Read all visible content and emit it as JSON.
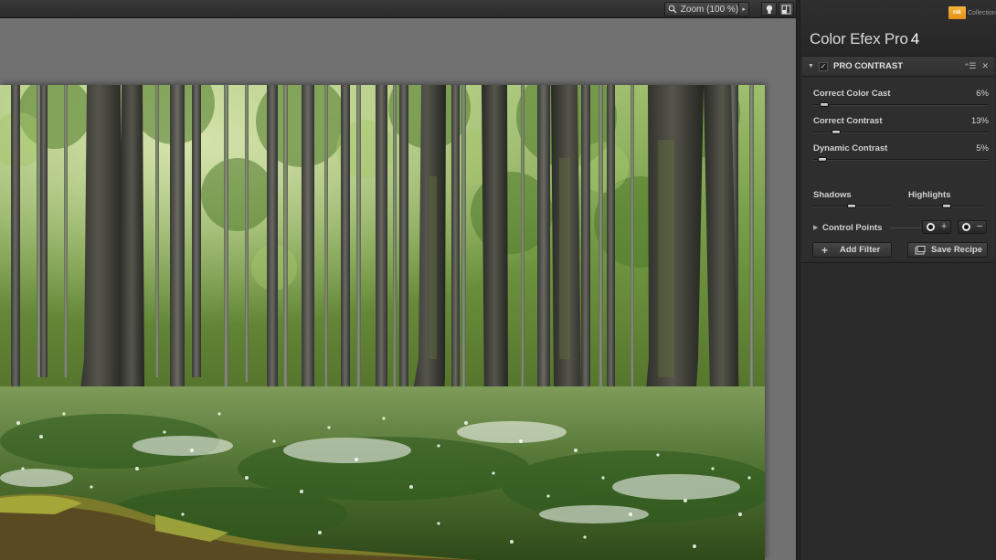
{
  "toolbar": {
    "zoom_label": "Zoom (100 %)",
    "zoom_arrow": "▸",
    "icons": [
      "search-icon",
      "lightbulb-icon",
      "compare-icon"
    ]
  },
  "panel": {
    "brand_logo": "nik",
    "brand_collection": "Collection",
    "app_title": "Color Efex Pro",
    "app_version": "4"
  },
  "filter": {
    "name": "PRO CONTRAST",
    "enabled": true,
    "sliders": [
      {
        "label": "Correct Color Cast",
        "value": "6%",
        "level": 0.06
      },
      {
        "label": "Correct Contrast",
        "value": "13%",
        "level": 0.13
      },
      {
        "label": "Dynamic Contrast",
        "value": "5%",
        "level": 0.05
      }
    ],
    "shadows": {
      "label": "Shadows",
      "level": 0.5
    },
    "highlights": {
      "label": "Highlights",
      "level": 0.5
    },
    "control_points_label": "Control Points"
  },
  "actions": {
    "add_filter": "Add Filter",
    "save_recipe": "Save Recipe"
  },
  "colors": {
    "accent_logo": "#f0a92a",
    "panel_bg": "#2b2b2b",
    "canvas_bg": "#717171"
  }
}
